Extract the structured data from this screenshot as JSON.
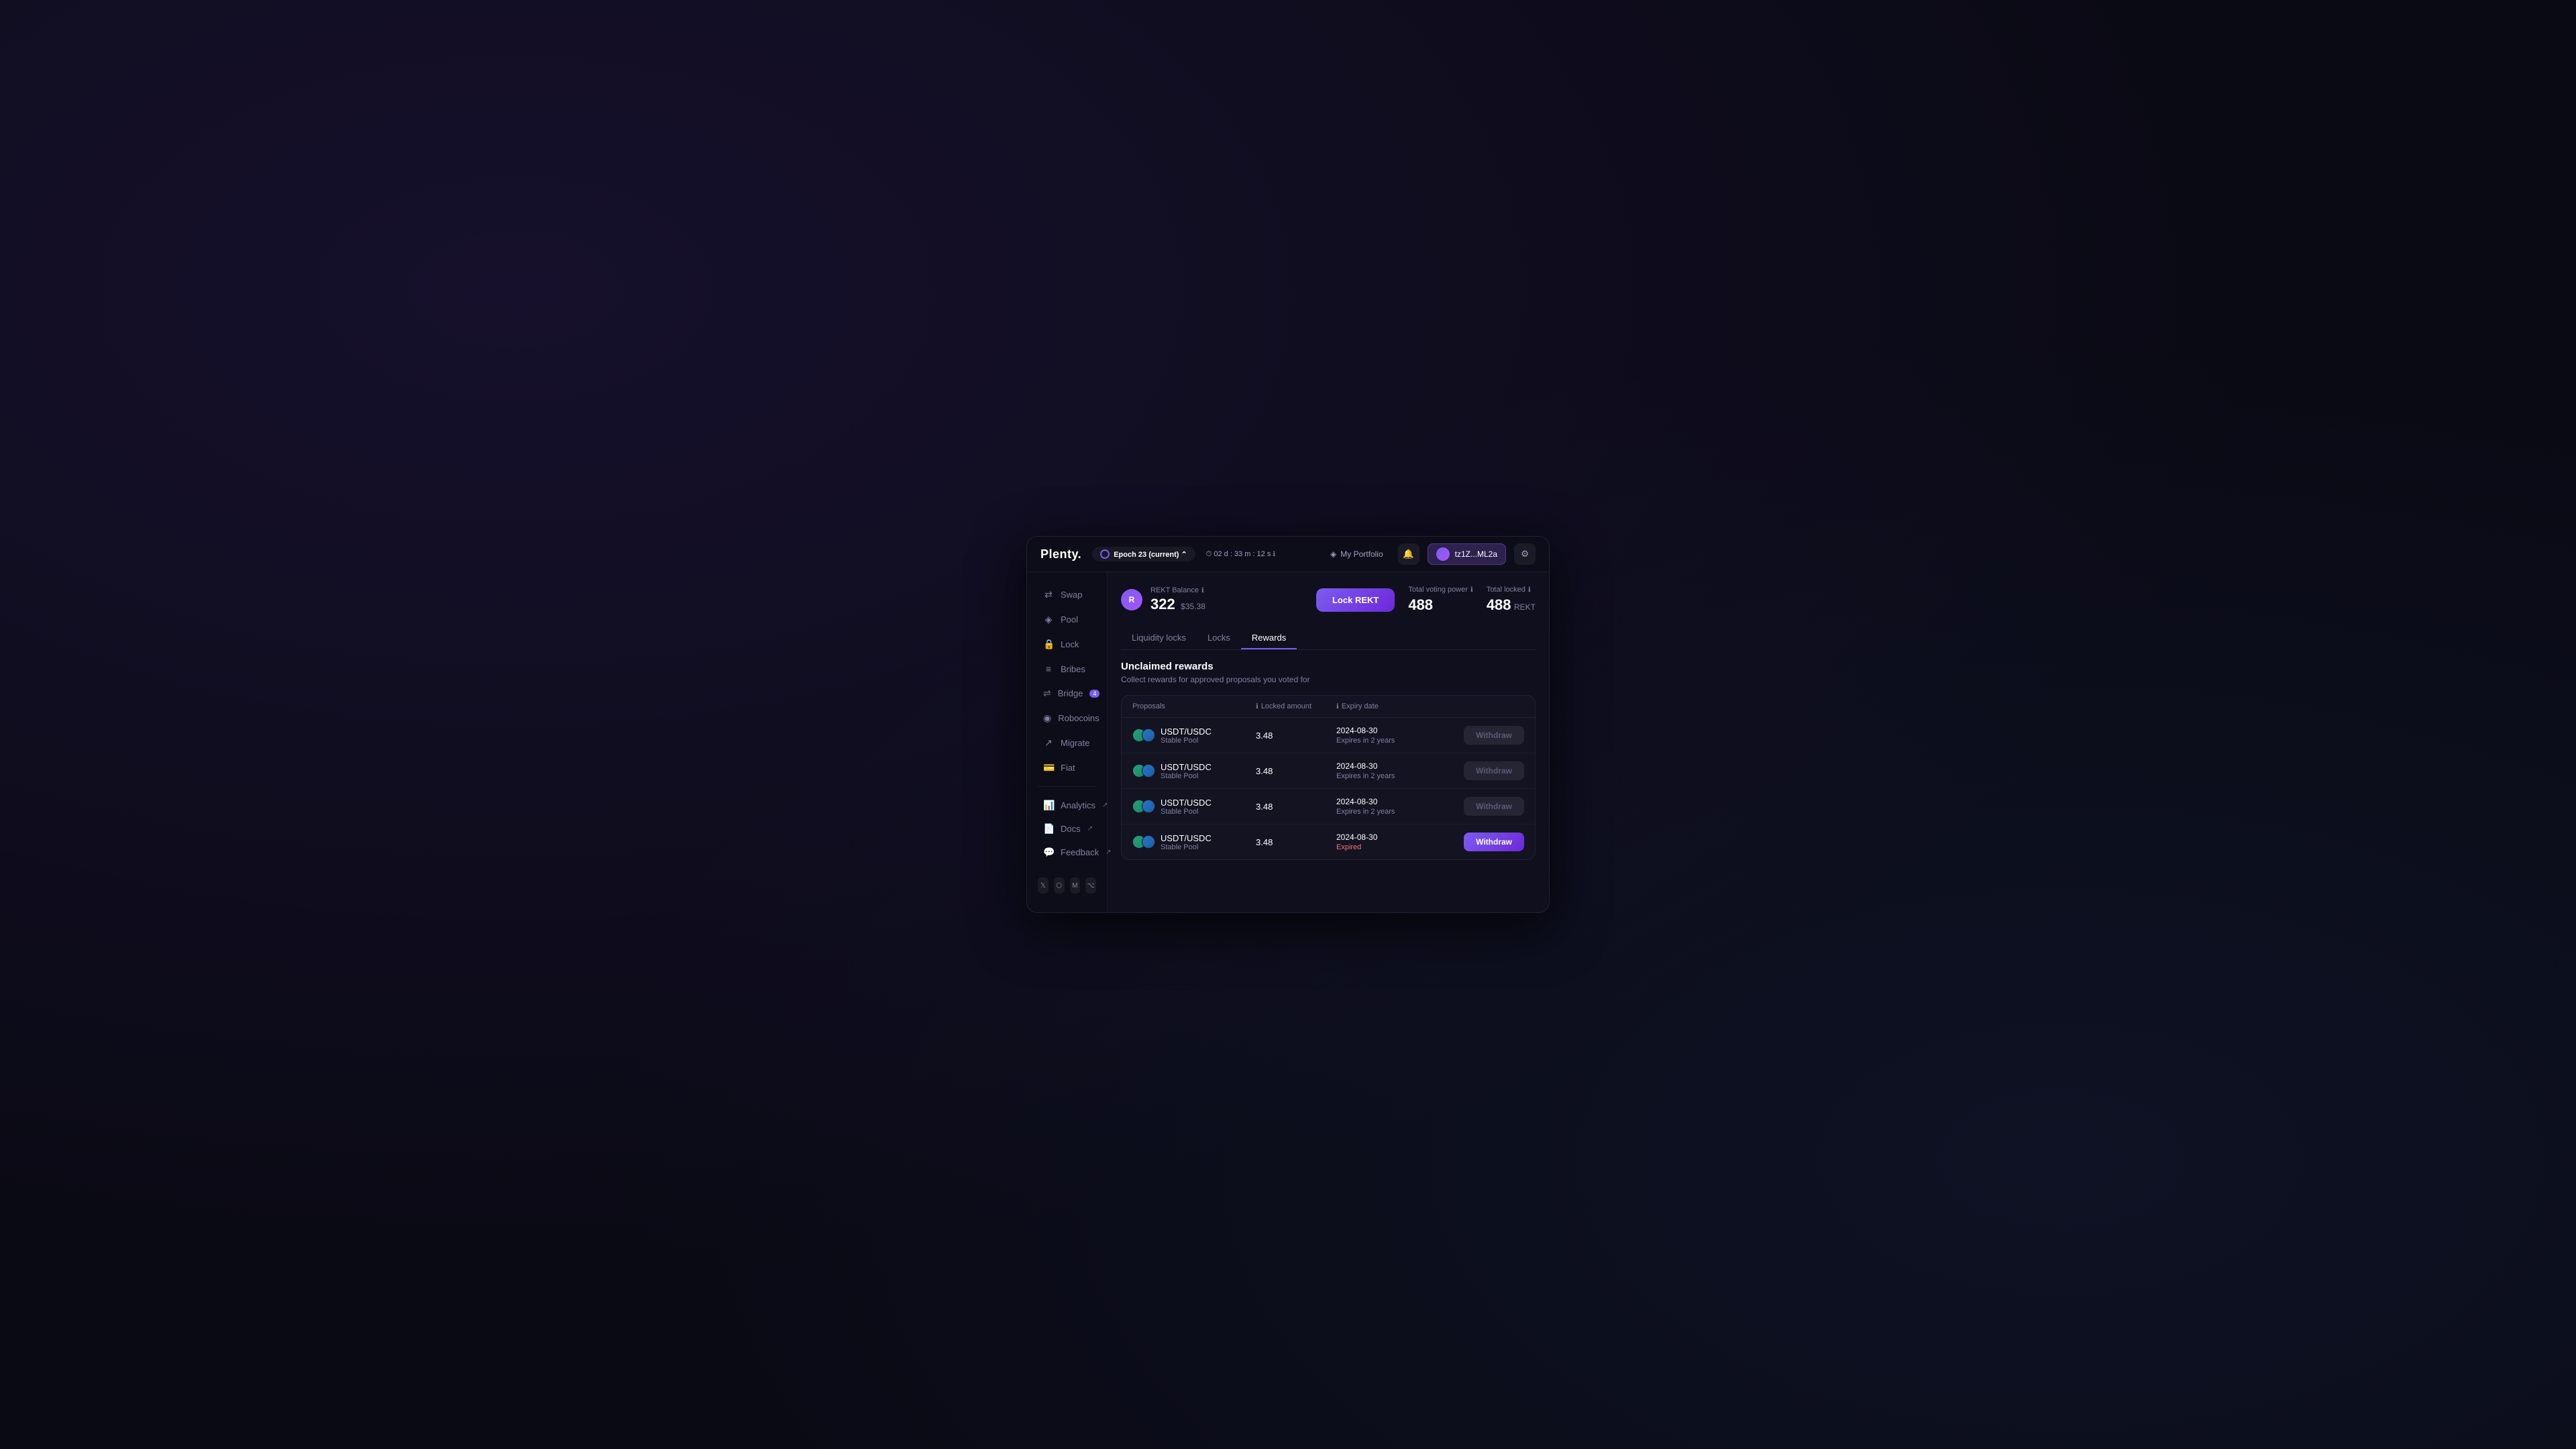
{
  "app": {
    "logo": "Plenty.",
    "epoch": {
      "label": "Epoch",
      "number": "23",
      "current_tag": "(current)",
      "timer": "02 d : 33 m : 12 s",
      "timer_icon": "⏱"
    },
    "header": {
      "portfolio_label": "My Portfolio",
      "wallet_address": "tz1Z...ML2a",
      "notification_icon": "🔔",
      "settings_icon": "⚙"
    }
  },
  "sidebar": {
    "items": [
      {
        "id": "swap",
        "label": "Swap",
        "icon": "⇄",
        "active": false
      },
      {
        "id": "pool",
        "label": "Pool",
        "icon": "◈",
        "active": false
      },
      {
        "id": "lock",
        "label": "Lock",
        "icon": "🔒",
        "active": false
      },
      {
        "id": "bribes",
        "label": "Bribes",
        "icon": "≡",
        "active": false,
        "badge": ""
      },
      {
        "id": "bridge",
        "label": "Bridge",
        "icon": "⇌",
        "active": false,
        "badge": "4"
      },
      {
        "id": "robocoins",
        "label": "Robocoins",
        "icon": "◉",
        "active": false
      },
      {
        "id": "migrate",
        "label": "Migrate",
        "icon": "↗",
        "active": false
      },
      {
        "id": "fiat",
        "label": "Fiat",
        "icon": "💳",
        "active": false
      }
    ],
    "bottom_items": [
      {
        "id": "analytics",
        "label": "Analytics",
        "icon": "📊",
        "external": true
      },
      {
        "id": "docs",
        "label": "Docs",
        "icon": "📄",
        "external": true
      },
      {
        "id": "feedback",
        "label": "Feedback",
        "icon": "💬",
        "external": true
      }
    ],
    "social": [
      {
        "id": "twitter",
        "icon": "𝕏"
      },
      {
        "id": "discord",
        "icon": "⬡"
      },
      {
        "id": "medium",
        "icon": "M"
      },
      {
        "id": "github",
        "icon": "⌥"
      }
    ]
  },
  "main": {
    "rekt_balance": {
      "label": "REKT Balance",
      "value": "322",
      "usd": "$35.38",
      "icon_letter": "R"
    },
    "lock_rekt_btn": "Lock REKT",
    "total_voting_power": {
      "label": "Total voting power",
      "value": "488"
    },
    "total_locked": {
      "label": "Total locked",
      "value": "488",
      "unit": "REKT"
    },
    "tabs": [
      {
        "id": "liquidity_locks",
        "label": "Liquidity locks",
        "active": false
      },
      {
        "id": "locks",
        "label": "Locks",
        "active": false
      },
      {
        "id": "rewards",
        "label": "Rewards",
        "active": true
      }
    ],
    "rewards_section": {
      "title": "Unclaimed rewards",
      "subtitle": "Collect rewards for approved proposals you voted for",
      "table": {
        "headers": [
          {
            "id": "proposals",
            "label": "Proposals",
            "icon": ""
          },
          {
            "id": "locked_amount",
            "label": "Locked amount",
            "icon": "ℹ"
          },
          {
            "id": "expiry_date",
            "label": "Expiry date",
            "icon": "ℹ"
          },
          {
            "id": "action",
            "label": ""
          }
        ],
        "rows": [
          {
            "id": "row1",
            "pair": "USDT/USDC",
            "type": "Stable Pool",
            "amount": "3.48",
            "expiry_date": "2024-08-30",
            "expiry_sub": "Expires in 2 years",
            "expired": false,
            "withdraw_enabled": false
          },
          {
            "id": "row2",
            "pair": "USDT/USDC",
            "type": "Stable Pool",
            "amount": "3.48",
            "expiry_date": "2024-08-30",
            "expiry_sub": "Expires in 2 years",
            "expired": false,
            "withdraw_enabled": false
          },
          {
            "id": "row3",
            "pair": "USDT/USDC",
            "type": "Stable Pool",
            "amount": "3.48",
            "expiry_date": "2024-08-30",
            "expiry_sub": "Expires in 2 years",
            "expired": false,
            "withdraw_enabled": false
          },
          {
            "id": "row4",
            "pair": "USDT/USDC",
            "type": "Stable Pool",
            "amount": "3.48",
            "expiry_date": "2024-08-30",
            "expiry_sub": "Expired",
            "expired": true,
            "withdraw_enabled": true
          }
        ],
        "withdraw_btn_label": "Withdraw"
      }
    }
  }
}
